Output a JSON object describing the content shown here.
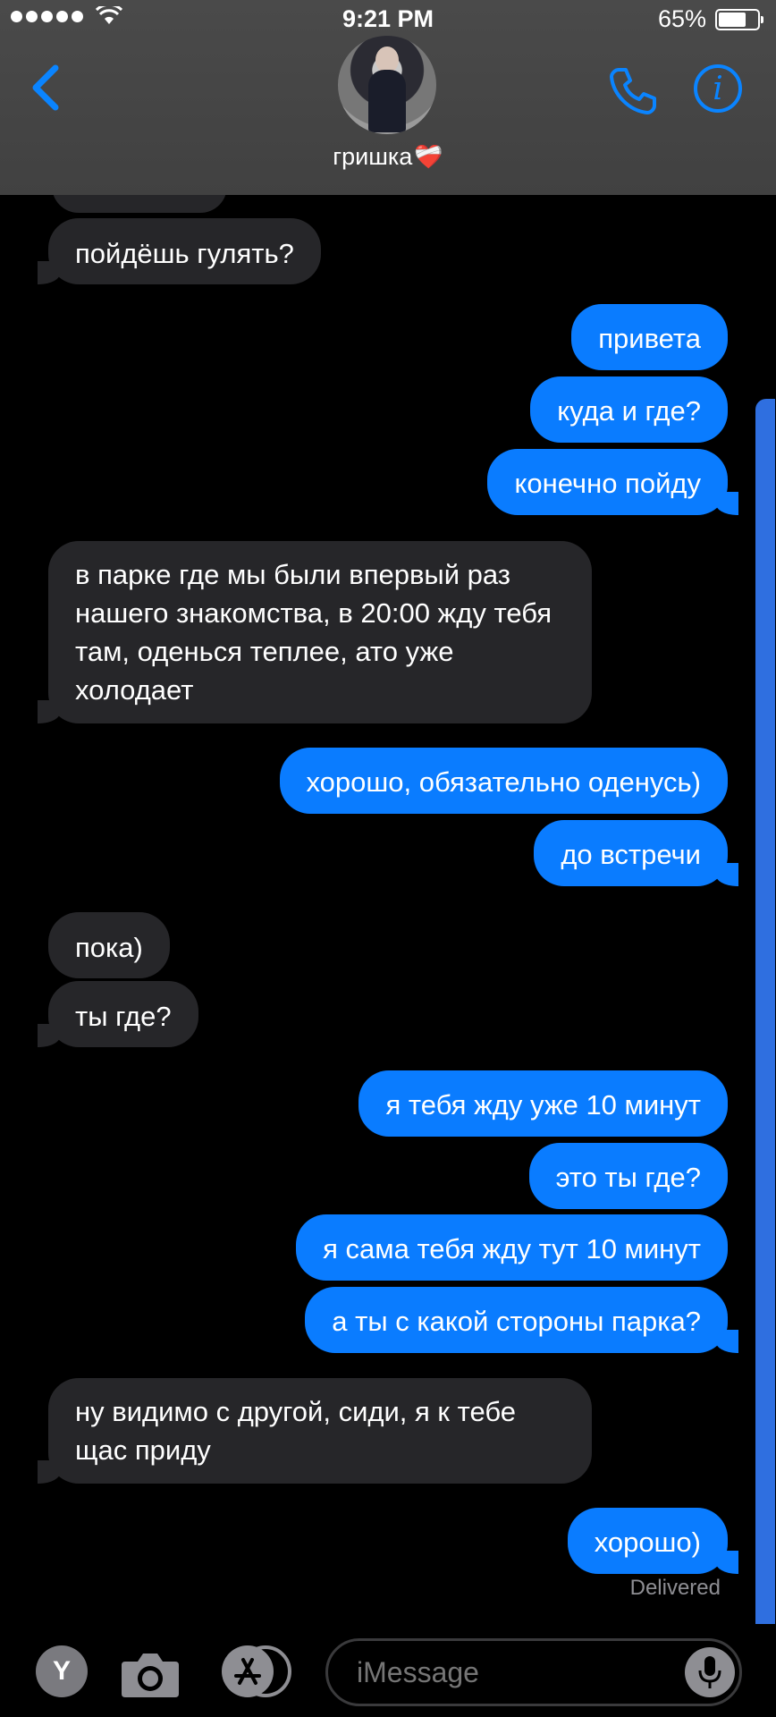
{
  "status_bar": {
    "time": "9:21 PM",
    "battery_percent_label": "65%",
    "battery_level": 0.65,
    "signal_dots": 5
  },
  "header": {
    "contact_name": "гришка",
    "contact_emoji": "❤️‍🩹",
    "back_icon": "chevron-left-icon",
    "call_icon": "phone-icon",
    "info_icon": "info-icon"
  },
  "messages": [
    {
      "side": "in",
      "text": "пойдёшь гулять?"
    },
    {
      "side": "out",
      "text": "привета"
    },
    {
      "side": "out",
      "text": "куда и где?"
    },
    {
      "side": "out",
      "text": "конечно пойду"
    },
    {
      "side": "in",
      "text": "в парке где мы были впервый раз нашего знакомства, в 20:00 жду тебя там, оденься теплее, ато уже холодает"
    },
    {
      "side": "out",
      "text": "хорошо, обязательно оденусь)"
    },
    {
      "side": "out",
      "text": "до встречи"
    },
    {
      "side": "in",
      "text": "пока)"
    },
    {
      "side": "in",
      "text": "ты где?"
    },
    {
      "side": "out",
      "text": "я тебя жду уже 10 минут"
    },
    {
      "side": "out",
      "text": "это ты где?"
    },
    {
      "side": "out",
      "text": "я сама тебя жду тут 10 минут"
    },
    {
      "side": "out",
      "text": "а ты с какой стороны парка?"
    },
    {
      "side": "in",
      "text": "ну видимо с другой, сиди, я к тебе щас приду"
    },
    {
      "side": "out",
      "text": "хорошо)"
    }
  ],
  "delivery_status": "Delivered",
  "composer": {
    "placeholder": "iMessage",
    "app_button_label": "Y"
  },
  "colors": {
    "outgoing_bubble": "#0a7cff",
    "incoming_bubble": "#262629",
    "accent": "#0a84ff",
    "header_bg": "#444444"
  }
}
